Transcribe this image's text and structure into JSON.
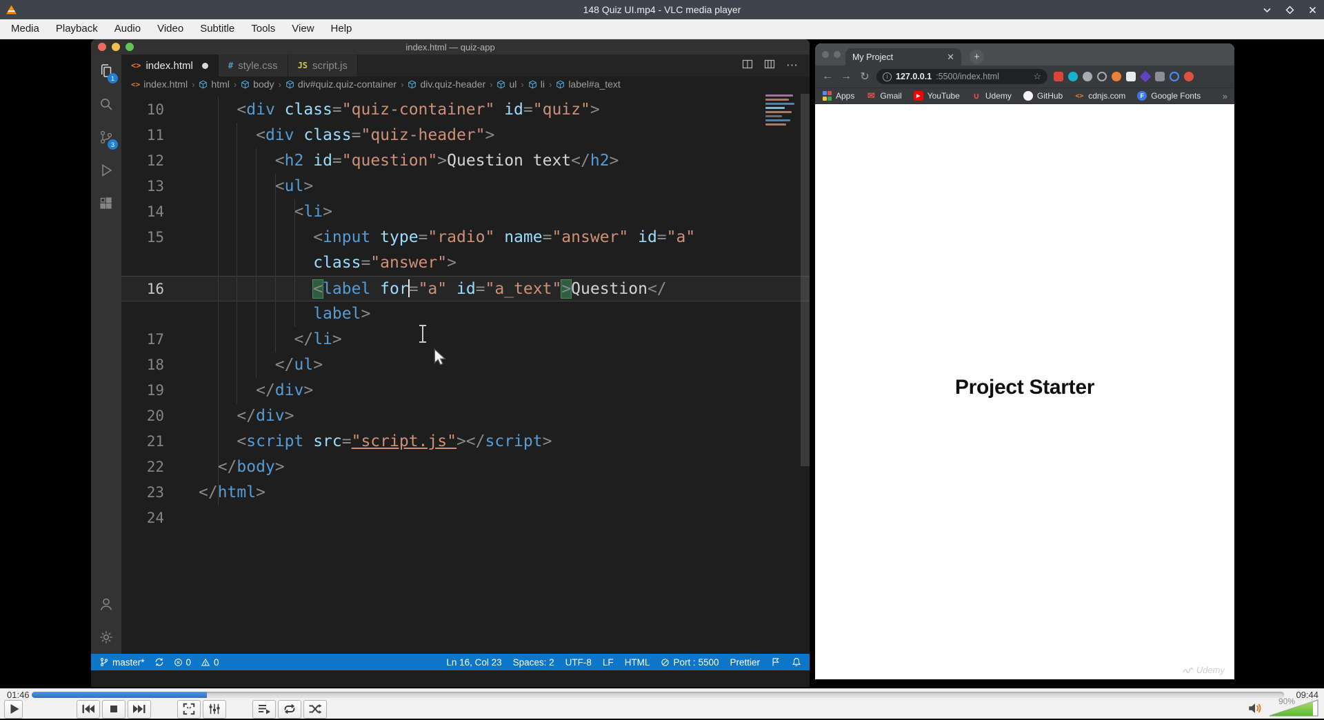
{
  "vlc": {
    "title": "148 Quiz UI.mp4 - VLC media player",
    "menu": [
      "Media",
      "Playback",
      "Audio",
      "Video",
      "Subtitle",
      "Tools",
      "View",
      "Help"
    ],
    "window_controls": [
      "minimize-icon",
      "maximize-icon",
      "close-icon"
    ],
    "time_elapsed": "01:46",
    "time_total": "09:44",
    "progress_percent": 14,
    "volume_label": "90%",
    "volume_percent": 90,
    "buttons": [
      "play",
      "previous",
      "stop",
      "next",
      "fullscreen",
      "extended-settings",
      "playlist",
      "loop",
      "random"
    ],
    "button_gaps_before": [
      0,
      78,
      3,
      3,
      38,
      3,
      38,
      3,
      3
    ]
  },
  "vscode": {
    "window_title": "index.html — quiz-app",
    "traffic_lights": [
      "close",
      "minimize",
      "zoom"
    ],
    "activity_bar": [
      {
        "icon": "explorer",
        "badge": "1",
        "active": true
      },
      {
        "icon": "search"
      },
      {
        "icon": "source-control",
        "badge": "3"
      },
      {
        "icon": "run-debug"
      },
      {
        "icon": "extensions"
      }
    ],
    "activity_bar_bottom": [
      {
        "icon": "account"
      },
      {
        "icon": "settings-gear"
      }
    ],
    "tabs": [
      {
        "label": "index.html",
        "icon": "html",
        "icon_color": "#e37933",
        "modified": true,
        "active": true
      },
      {
        "label": "style.css",
        "icon": "css",
        "icon_color": "#519aba",
        "modified": false,
        "active": false
      },
      {
        "label": "script.js",
        "icon": "js",
        "icon_color": "#cbcb41",
        "modified": false,
        "active": false
      }
    ],
    "editor_actions": [
      "split-editor-icon",
      "toggle-layout-icon",
      "more-actions-icon"
    ],
    "breadcrumb": [
      "index.html",
      "html",
      "body",
      "div#quiz.quiz-container",
      "div.quiz-header",
      "ul",
      "li",
      "label#a_text"
    ],
    "code_rows": [
      {
        "n": "10",
        "indent": 4,
        "parts": [
          [
            "p",
            "<"
          ],
          [
            "t",
            "div"
          ],
          [
            "x",
            " "
          ],
          [
            "a",
            "class"
          ],
          [
            "p",
            "="
          ],
          [
            "s",
            "\"quiz-container\""
          ],
          [
            "x",
            " "
          ],
          [
            "a",
            "id"
          ],
          [
            "p",
            "="
          ],
          [
            "s",
            "\"quiz\""
          ],
          [
            "p",
            ">"
          ]
        ]
      },
      {
        "n": "11",
        "indent": 6,
        "parts": [
          [
            "p",
            "<"
          ],
          [
            "t",
            "div"
          ],
          [
            "x",
            " "
          ],
          [
            "a",
            "class"
          ],
          [
            "p",
            "="
          ],
          [
            "s",
            "\"quiz-header\""
          ],
          [
            "p",
            ">"
          ]
        ]
      },
      {
        "n": "12",
        "indent": 8,
        "parts": [
          [
            "p",
            "<"
          ],
          [
            "t",
            "h2"
          ],
          [
            "x",
            " "
          ],
          [
            "a",
            "id"
          ],
          [
            "p",
            "="
          ],
          [
            "s",
            "\"question\""
          ],
          [
            "p",
            ">"
          ],
          [
            "x",
            "Question text"
          ],
          [
            "p",
            "</"
          ],
          [
            "t",
            "h2"
          ],
          [
            "p",
            ">"
          ]
        ]
      },
      {
        "n": "13",
        "indent": 8,
        "parts": [
          [
            "p",
            "<"
          ],
          [
            "t",
            "ul"
          ],
          [
            "p",
            ">"
          ]
        ]
      },
      {
        "n": "14",
        "indent": 10,
        "parts": [
          [
            "p",
            "<"
          ],
          [
            "t",
            "li"
          ],
          [
            "p",
            ">"
          ]
        ]
      },
      {
        "n": "15",
        "indent": 12,
        "parts": [
          [
            "p",
            "<"
          ],
          [
            "t",
            "input"
          ],
          [
            "x",
            " "
          ],
          [
            "a",
            "type"
          ],
          [
            "p",
            "="
          ],
          [
            "s",
            "\"radio\""
          ],
          [
            "x",
            " "
          ],
          [
            "a",
            "name"
          ],
          [
            "p",
            "="
          ],
          [
            "s",
            "\"answer\""
          ],
          [
            "x",
            " "
          ],
          [
            "a",
            "id"
          ],
          [
            "p",
            "="
          ],
          [
            "s",
            "\"a\""
          ]
        ]
      },
      {
        "n": "",
        "indent": 12,
        "parts": [
          [
            "a",
            "class"
          ],
          [
            "p",
            "="
          ],
          [
            "s",
            "\"answer\""
          ],
          [
            "p",
            ">"
          ]
        ]
      },
      {
        "n": "16",
        "indent": 12,
        "current": true,
        "parts": [
          [
            "hb",
            "<"
          ],
          [
            "t",
            "label"
          ],
          [
            "x",
            " "
          ],
          [
            "a",
            "for"
          ],
          [
            "caret",
            ""
          ],
          [
            "p",
            "="
          ],
          [
            "s",
            "\"a\""
          ],
          [
            "x",
            " "
          ],
          [
            "a",
            "id"
          ],
          [
            "p",
            "="
          ],
          [
            "s",
            "\"a_text\""
          ],
          [
            "hb",
            ">"
          ],
          [
            "x",
            "Question"
          ],
          [
            "p",
            "</"
          ]
        ]
      },
      {
        "n": "",
        "indent": 12,
        "parts": [
          [
            "t",
            "label"
          ],
          [
            "p",
            ">"
          ]
        ]
      },
      {
        "n": "17",
        "indent": 10,
        "parts": [
          [
            "p",
            "</"
          ],
          [
            "t",
            "li"
          ],
          [
            "p",
            ">"
          ]
        ]
      },
      {
        "n": "18",
        "indent": 8,
        "parts": [
          [
            "p",
            "</"
          ],
          [
            "t",
            "ul"
          ],
          [
            "p",
            ">"
          ]
        ]
      },
      {
        "n": "19",
        "indent": 6,
        "parts": [
          [
            "p",
            "</"
          ],
          [
            "t",
            "div"
          ],
          [
            "p",
            ">"
          ]
        ]
      },
      {
        "n": "20",
        "indent": 4,
        "parts": [
          [
            "p",
            "</"
          ],
          [
            "t",
            "div"
          ],
          [
            "p",
            ">"
          ]
        ]
      },
      {
        "n": "21",
        "indent": 4,
        "parts": [
          [
            "p",
            "<"
          ],
          [
            "t",
            "script"
          ],
          [
            "x",
            " "
          ],
          [
            "a",
            "src"
          ],
          [
            "p",
            "="
          ],
          [
            "su",
            "\"script.js\""
          ],
          [
            "p",
            ">"
          ],
          [
            "p",
            "</"
          ],
          [
            "t",
            "script"
          ],
          [
            "p",
            ">"
          ]
        ]
      },
      {
        "n": "22",
        "indent": 2,
        "parts": [
          [
            "p",
            "</"
          ],
          [
            "t",
            "body"
          ],
          [
            "p",
            ">"
          ]
        ]
      },
      {
        "n": "23",
        "indent": 0,
        "parts": [
          [
            "p",
            "</"
          ],
          [
            "t",
            "html"
          ],
          [
            "p",
            ">"
          ]
        ]
      },
      {
        "n": "24",
        "indent": 0,
        "parts": []
      }
    ],
    "status_left": {
      "branch": "master*",
      "errors": "0",
      "warnings": "0"
    },
    "status_right": [
      {
        "label": "Ln 16, Col 23"
      },
      {
        "label": "Spaces: 2"
      },
      {
        "label": "UTF-8"
      },
      {
        "label": "LF"
      },
      {
        "label": "HTML"
      },
      {
        "icon": "circle-slash-icon",
        "label": "Port : 5500"
      },
      {
        "label": "Prettier"
      },
      {
        "icon": "pennant-icon",
        "label": ""
      },
      {
        "icon": "bell-icon",
        "label": ""
      }
    ]
  },
  "browser": {
    "tab_title": "My Project",
    "tab_close": "✕",
    "new_tab": "+",
    "url_host": "127.0.0.1",
    "url_rest": ":5500/index.html",
    "bookmarks": [
      {
        "icon": "apps-grid-icon",
        "label": "Apps"
      },
      {
        "icon": "gmail-icon",
        "label": "Gmail"
      },
      {
        "icon": "youtube-icon",
        "label": "YouTube"
      },
      {
        "icon": "udemy-icon",
        "label": "Udemy"
      },
      {
        "icon": "github-icon",
        "label": "GitHub"
      },
      {
        "icon": "cdnjs-icon",
        "label": "cdnjs.com"
      },
      {
        "icon": "google-fonts-icon",
        "label": "Google Fonts"
      }
    ],
    "bookmarks_overflow": "»",
    "extension_icons": [
      "red-square",
      "teal-circle",
      "gray-circle",
      "gray-ring",
      "orange-circle",
      "white-square",
      "purple-diamond",
      "gray-rounded",
      "blue-ring",
      "red-circle"
    ],
    "page_heading": "Project Starter",
    "watermark": "Udemy"
  },
  "colors": {
    "vlc_titlebar": "#3e444c",
    "statusbar_blue": "#0e76c8",
    "seek_blue": "#2f6fc0",
    "volume_green": "#77c33c",
    "mac_red": "#ec6a5e",
    "mac_yellow": "#f5bf4f",
    "mac_green": "#61c454",
    "badge_blue": "#1f7fd4",
    "code_tag": "#569cd6",
    "code_attr": "#9cdcfe",
    "code_string": "#ce9178",
    "code_punct": "#8a8a8a",
    "code_text": "#d4d4d4"
  }
}
